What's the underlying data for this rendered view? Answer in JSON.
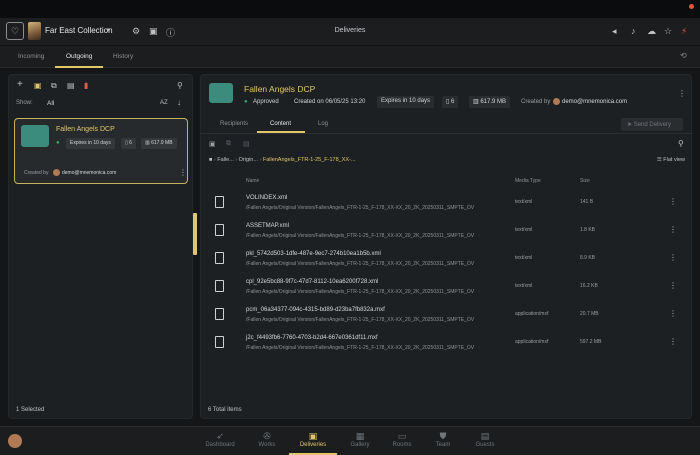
{
  "header": {
    "collection": "Far East Collection",
    "title": "Deliveries"
  },
  "tabs": [
    "Incoming",
    "Outgoing",
    "History"
  ],
  "left": {
    "show_label": "Show:",
    "show_value": "All",
    "sort_label": "AZ",
    "card": {
      "title": "Fallen Angels DCP",
      "expires": "Expires in 10 days",
      "files": "6",
      "size": "617.9 MB",
      "created_by_label": "Created by",
      "created_by": "demo@mnemonica.com"
    },
    "footer": "1 Selected"
  },
  "right": {
    "title": "Fallen Angels DCP",
    "status": "Approved",
    "created_on": "Created on 06/05/25 13:20",
    "expires": "Expires in 10 days",
    "files": "6",
    "size": "617.9 MB",
    "created_by_label": "Created by",
    "created_by": "demo@mnemonica.com",
    "tabs": [
      "Recipients",
      "Content",
      "Log"
    ],
    "send_button": "Send Delivery",
    "breadcrumb": [
      "Falle...",
      "Origin...",
      "FallenAngels_FTR-1-25_F-178_XX-..."
    ],
    "flat_view": "Flat view",
    "columns": [
      "Name",
      "Media Type",
      "Size"
    ],
    "files_list": [
      {
        "name": "VOLINDEX.xml",
        "path": "/Fallen Angels/Original Version/FallenAngels_FTR-1-25_F-178_XX-XX_20_2K_20250311_SMPTE_OV",
        "type": "text/xml",
        "size": "141 B"
      },
      {
        "name": "ASSETMAP.xml",
        "path": "/Fallen Angels/Original Version/FallenAngels_FTR-1-25_F-178_XX-XX_20_2K_20250311_SMPTE_OV",
        "type": "text/xml",
        "size": "1.8 KB"
      },
      {
        "name": "pkl_5742d503-1dfe-487e-9ec7-274b10ea1b5b.xml",
        "path": "/Fallen Angels/Original Version/FallenAngels_FTR-1-25_F-178_XX-XX_20_2K_20250311_SMPTE_OV",
        "type": "text/xml",
        "size": "8.9 KB"
      },
      {
        "name": "cpl_92e5bc88-9f7c-47d7-8112-10ea6200f728.xml",
        "path": "/Fallen Angels/Original Version/FallenAngels_FTR-1-25_F-178_XX-XX_20_2K_20250311_SMPTE_OV",
        "type": "text/xml",
        "size": "16.2 KB"
      },
      {
        "name": "pcm_06a34377-094c-4315-bd89-d23ba7fb832a.mxf",
        "path": "/Fallen Angels/Original Version/FallenAngels_FTR-1-25_F-178_XX-XX_20_2K_20250311_SMPTE_OV",
        "type": "application/mxf",
        "size": "20.7 MB"
      },
      {
        "name": "j2c_f4493fb6-7760-4703-b2d4-667e0361df11.mxf",
        "path": "/Fallen Angels/Original Version/FallenAngels_FTR-1-25_F-178_XX-XX_20_2K_20250311_SMPTE_OV",
        "type": "application/mxf",
        "size": "597.2 MB"
      }
    ],
    "footer": "6 Total items"
  },
  "nav": [
    "Dashboard",
    "Works",
    "Deliveries",
    "Gallery",
    "Rooms",
    "Team",
    "Guests"
  ],
  "colors": {
    "accent": "#e1c76a",
    "approved": "#3fae6a",
    "deliveries_icon": "#3b8c7d"
  }
}
